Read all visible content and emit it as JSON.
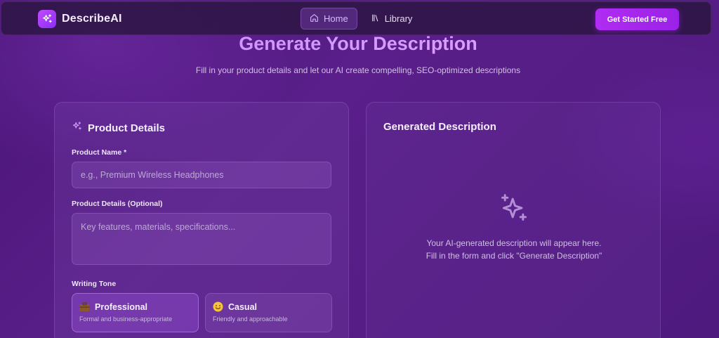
{
  "nav": {
    "brand": "DescribeAI",
    "links": [
      {
        "label": "Home",
        "icon": "home-icon",
        "active": true
      },
      {
        "label": "Library",
        "icon": "library-icon",
        "active": false
      }
    ],
    "cta_label": "Get Started Free"
  },
  "hero": {
    "title": "Generate Your Description",
    "subtitle": "Fill in your product details and let our AI create compelling, SEO-optimized descriptions"
  },
  "form": {
    "title": "Product Details",
    "product_name_label": "Product Name *",
    "product_name_placeholder": "e.g., Premium Wireless Headphones",
    "product_details_label": "Product Details (Optional)",
    "product_details_placeholder": "Key features, materials, specifications...",
    "tone_label": "Writing Tone",
    "tones": [
      {
        "name": "Professional",
        "desc": "Formal and business-appropriate",
        "icon": "briefcase-icon",
        "selected": true
      },
      {
        "name": "Casual",
        "desc": "Friendly and approachable",
        "icon": "smile-icon",
        "selected": false
      }
    ]
  },
  "output": {
    "title": "Generated Description",
    "empty_line1": "Your AI-generated description will appear here.",
    "empty_line2": "Fill in the form and click \"Generate Description\""
  },
  "colors": {
    "background": "#4e1a7e",
    "accent": "#a326ec",
    "title_gradient_start": "#c58cff",
    "title_gradient_end": "#e7a6ff"
  }
}
